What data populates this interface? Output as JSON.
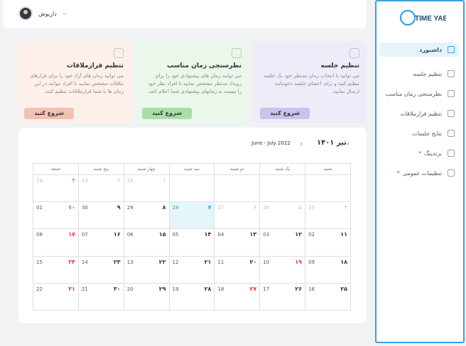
{
  "header": {
    "user_name": "داریوش"
  },
  "sidebar": {
    "logo_text": "TIME YAB",
    "items": [
      {
        "label": "داشبورد",
        "icon": "grid-icon",
        "active": true,
        "required": false
      },
      {
        "label": "تنظیم جلسه",
        "icon": "calendar-check-icon",
        "active": false,
        "required": false
      },
      {
        "label": "نظرسنجی زمان مناسب",
        "icon": "clipboard-icon",
        "active": false,
        "required": false
      },
      {
        "label": "تنظیم قرارملاقات",
        "icon": "users-icon",
        "active": false,
        "required": false
      },
      {
        "label": "نتایج جلسات",
        "icon": "document-icon",
        "active": false,
        "required": false
      },
      {
        "label": "برندینگ",
        "icon": "brand-icon",
        "active": false,
        "required": true
      },
      {
        "label": "تنظیمات عمومی",
        "icon": "gear-icon",
        "active": false,
        "required": true
      }
    ]
  },
  "cards": [
    {
      "title": "تنظیم جلسه",
      "desc": "می توانید با انتخاب زمان مدنظر خود یک جلسه تنظیم کنید و برای اعضای جلسه دعوتنامه ارسال نمایید.",
      "button": "شروع کنید",
      "bg": "#efecf9",
      "btn": "#c9c3ee",
      "icon": "calendar-check-icon"
    },
    {
      "title": "نظرسنجی زمان مناسب",
      "desc": "می توانید زمان های پیشنهادی خود را برای رویداد مدنظر مشخص نمایید تا افراد نظر خود را نسبت به زمانهای پیشنهادی شما اعلام کنند.",
      "button": "شروع کنید",
      "bg": "#eaf7ea",
      "btn": "#a9dea8",
      "icon": "clipboard-icon"
    },
    {
      "title": "تنظیم قرارملاقات",
      "desc": "می توانید زمان های آزاد خود را برای قرارهای ملاقات مشخص نمایید تا افراد بتوانند در این زمان ها با شما قرارملاقات تنظیم کنند.",
      "button": "شروع کنید",
      "bg": "#fdf0ea",
      "btn": "#f3c1b1",
      "icon": "users-icon"
    }
  ],
  "calendar": {
    "persian_month": "تیر ۱۴۰۱",
    "greg_range": "June - July 2022",
    "weekdays": [
      "شنبه",
      "یک شنبه",
      "دو شنبه",
      "سه شنبه",
      "چهار شنبه",
      "پنج شنبه",
      "جمعه"
    ],
    "weeks": [
      [
        {
          "p": "",
          "g": ""
        },
        {
          "p": "",
          "g": ""
        },
        {
          "p": "",
          "g": ""
        },
        {
          "p": "",
          "g": ""
        },
        {
          "p": "۱",
          "g": "22",
          "fade": true
        },
        {
          "p": "۲",
          "g": "23",
          "fade": true
        },
        {
          "p": "۳",
          "g": "24",
          "fade": true,
          "red": true
        }
      ],
      [
        {
          "p": "۴",
          "g": "25",
          "fade": true
        },
        {
          "p": "۵",
          "g": "26",
          "fade": true
        },
        {
          "p": "۶",
          "g": "27",
          "fade": true
        },
        {
          "p": "۷",
          "g": "28",
          "today": true
        },
        {
          "p": "۸",
          "g": "29"
        },
        {
          "p": "۹",
          "g": "30"
        },
        {
          "p": "۱۰",
          "g": "01",
          "red": true
        }
      ],
      [
        {
          "p": "۱۱",
          "g": "02"
        },
        {
          "p": "۱۲",
          "g": "03"
        },
        {
          "p": "۱۳",
          "g": "04"
        },
        {
          "p": "۱۴",
          "g": "05"
        },
        {
          "p": "۱۵",
          "g": "06"
        },
        {
          "p": "۱۶",
          "g": "07"
        },
        {
          "p": "۱۷",
          "g": "08",
          "red": true
        }
      ],
      [
        {
          "p": "۱۸",
          "g": "09"
        },
        {
          "p": "۱۹",
          "g": "10",
          "red": true
        },
        {
          "p": "۲۰",
          "g": "11"
        },
        {
          "p": "۲۱",
          "g": "12"
        },
        {
          "p": "۲۲",
          "g": "13"
        },
        {
          "p": "۲۳",
          "g": "14"
        },
        {
          "p": "۲۴",
          "g": "15",
          "red": true
        }
      ],
      [
        {
          "p": "۲۵",
          "g": "16"
        },
        {
          "p": "۲۶",
          "g": "17"
        },
        {
          "p": "۲۷",
          "g": "18",
          "red": true
        },
        {
          "p": "۲۸",
          "g": "19"
        },
        {
          "p": "۲۹",
          "g": "20"
        },
        {
          "p": "۳۰",
          "g": "21"
        },
        {
          "p": "۳۱",
          "g": "22",
          "red": true
        }
      ]
    ]
  }
}
